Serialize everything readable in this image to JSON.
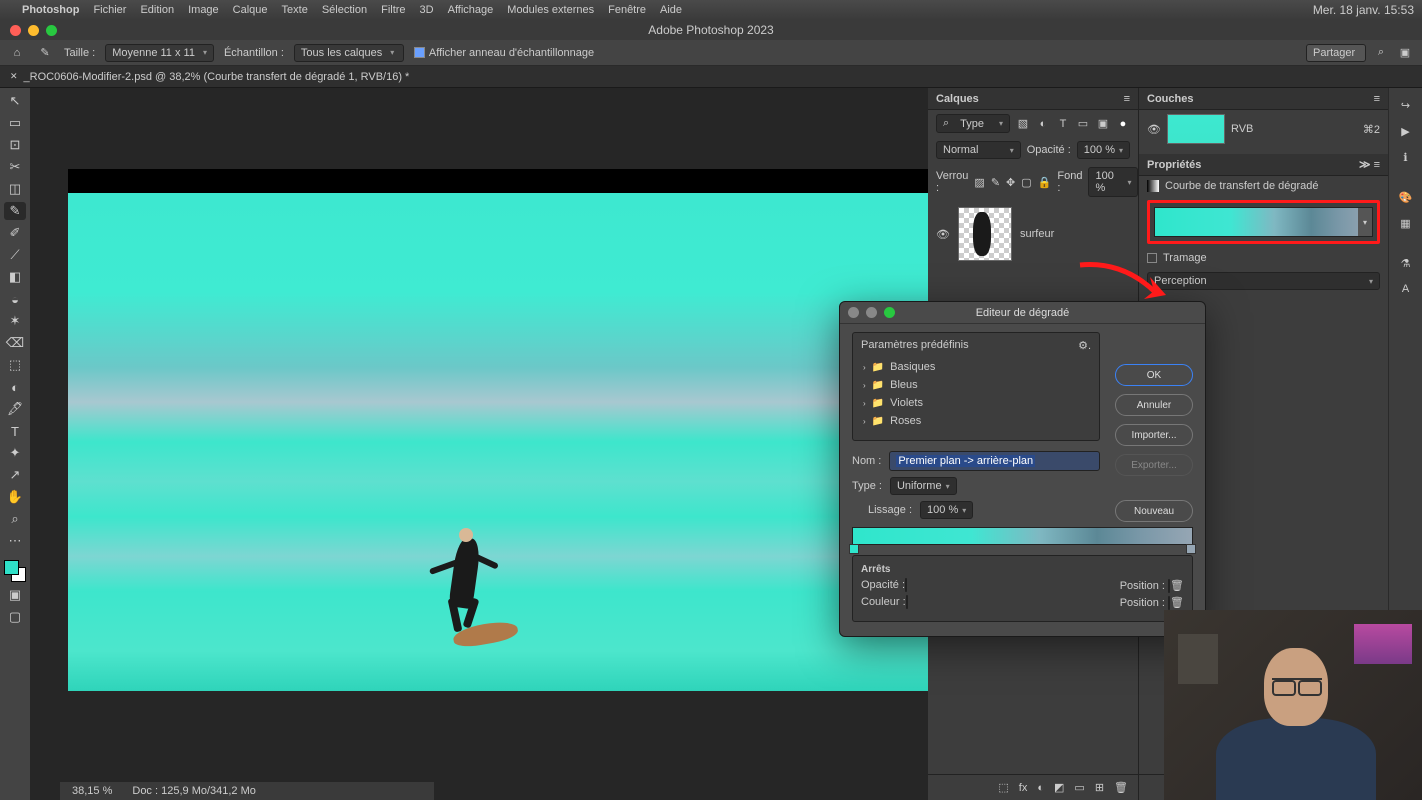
{
  "mac_menu": {
    "apple": "",
    "items": [
      "Photoshop",
      "Fichier",
      "Edition",
      "Image",
      "Calque",
      "Texte",
      "Sélection",
      "Filtre",
      "3D",
      "Affichage",
      "Modules externes",
      "Fenêtre",
      "Aide"
    ],
    "status_icons": [
      "🎥",
      "🦋",
      "🔴",
      "⏺",
      "▢",
      "📋",
      "🗑",
      "①",
      "👤",
      "⌨",
      "⊞",
      "📍",
      "📶",
      "🔊",
      "◐",
      "🇧🇪",
      "ᛒ",
      "⚙",
      "⌕",
      "≡"
    ],
    "clock": "Mer. 18 janv.  15:53"
  },
  "window_title": "Adobe Photoshop 2023",
  "options_bar": {
    "size_label": "Taille :",
    "size_value": "Moyenne 11 x 11",
    "sample_label": "Échantillon :",
    "sample_value": "Tous les calques",
    "ring_label": "Afficher anneau d'échantillonnage",
    "share": "Partager"
  },
  "doc_tab": {
    "title": "_ROC0606-Modifier-2.psd @ 38,2% (Courbe transfert de dégradé 1, RVB/16) *"
  },
  "tools": [
    "↖",
    "▭",
    "⊡",
    "✂",
    "◫",
    "✎",
    "✐",
    "⟋",
    "◧",
    "◒",
    "✶",
    "⌫",
    "⬚",
    "◐",
    "🖋",
    "T",
    "✦",
    "↗",
    "✋",
    "⌕",
    "⋯"
  ],
  "layers_panel": {
    "title": "Calques",
    "kind_label": "Type",
    "blend": "Normal",
    "opacity_label": "Opacité :",
    "opacity_value": "100 %",
    "lock_label": "Verrou :",
    "fill_label": "Fond :",
    "fill_value": "100 %",
    "layer_name": "surfeur"
  },
  "channels_panel": {
    "title": "Couches",
    "rgb": "RVB",
    "shortcut": "⌘2"
  },
  "properties_panel": {
    "title": "Propriétés",
    "adj_name": "Courbe de transfert de dégradé",
    "dither": "Tramage",
    "method": "Perception"
  },
  "gradient_editor": {
    "title": "Editeur de dégradé",
    "presets_label": "Paramètres prédéfinis",
    "folders": [
      "Basiques",
      "Bleus",
      "Violets",
      "Roses"
    ],
    "name_label": "Nom :",
    "name_value": "Premier plan -> arrière-plan",
    "type_label": "Type :",
    "type_value": "Uniforme",
    "smooth_label": "Lissage :",
    "smooth_value": "100 %",
    "stops_label": "Arrêts",
    "opacity_label": "Opacité :",
    "position_label": "Position :",
    "color_label": "Couleur :",
    "btn_ok": "OK",
    "btn_cancel": "Annuler",
    "btn_import": "Importer...",
    "btn_export": "Exporter...",
    "btn_new": "Nouveau"
  },
  "status": {
    "zoom": "38,15 %",
    "doc": "Doc : 125,9 Mo/341,2 Mo"
  },
  "panel_footer_icons": [
    "⬚",
    "fx",
    "◐",
    "◩",
    "▭",
    "⊞",
    "🗑"
  ],
  "prop_footer_icons": [
    "▣",
    "⊙",
    "↺",
    "◉",
    "🗑"
  ]
}
